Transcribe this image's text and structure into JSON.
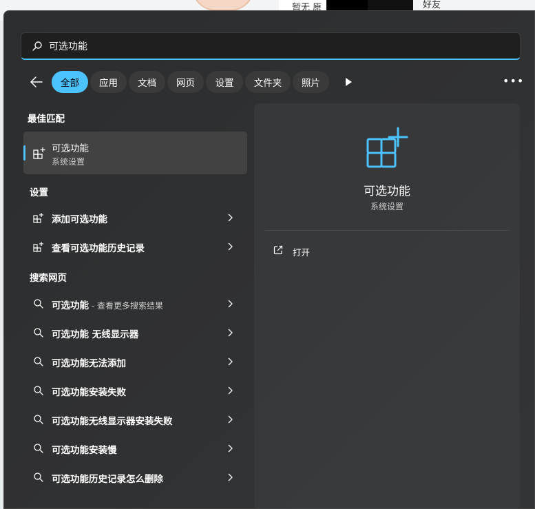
{
  "background": {
    "text1": "暂无 原",
    "text2": "好友"
  },
  "search": {
    "value": "可选功能",
    "placeholder": ""
  },
  "filters": {
    "back_icon": "back-arrow-icon",
    "chips": [
      "全部",
      "应用",
      "文档",
      "网页",
      "设置",
      "文件夹",
      "照片"
    ],
    "active": "全部",
    "more_icon": "more-icon"
  },
  "left": {
    "best_match_heading": "最佳匹配",
    "best_match": {
      "title": "可选功能",
      "subtitle": "系统设置",
      "icon": "optional-features-icon"
    },
    "settings_heading": "设置",
    "settings_items": [
      {
        "label": "添加可选功能"
      },
      {
        "label": "查看可选功能历史记录"
      }
    ],
    "web_heading": "搜索网页",
    "web_items": [
      {
        "label": "可选功能",
        "sub": " - 查看更多搜索结果"
      },
      {
        "label": "可选功能 无线显示器",
        "sub": ""
      },
      {
        "label": "可选功能无法添加",
        "sub": ""
      },
      {
        "label": "可选功能安装失败",
        "sub": ""
      },
      {
        "label": "可选功能无线显示器安装失败",
        "sub": ""
      },
      {
        "label": "可选功能安装慢",
        "sub": ""
      },
      {
        "label": "可选功能历史记录怎么删除",
        "sub": ""
      }
    ]
  },
  "detail": {
    "title": "可选功能",
    "subtitle": "系统设置",
    "action_open": "打开"
  },
  "colors": {
    "accent": "#4cc2ff",
    "panel": "#2f3031",
    "item_hover": "#424242"
  }
}
